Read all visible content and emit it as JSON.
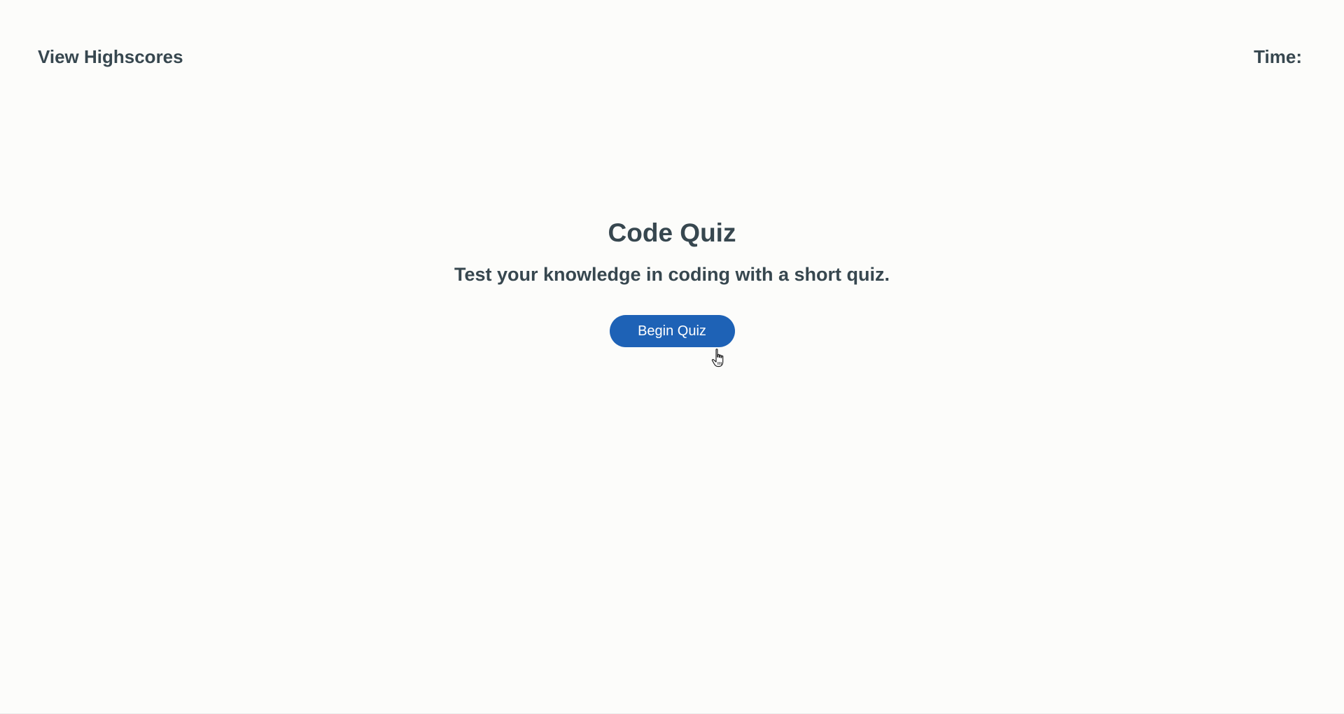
{
  "header": {
    "highscores_label": "View Highscores",
    "time_label": "Time:",
    "time_value": ""
  },
  "intro": {
    "title": "Code Quiz",
    "subtitle": "Test your knowledge in coding with a short quiz.",
    "begin_button_label": "Begin Quiz"
  },
  "icons": {
    "pointer": "hand-pointer-cursor-icon"
  },
  "colors": {
    "background": "#fcfcfa",
    "text": "#37474f",
    "button": "#1e62b6",
    "button_text": "#ffffff"
  }
}
